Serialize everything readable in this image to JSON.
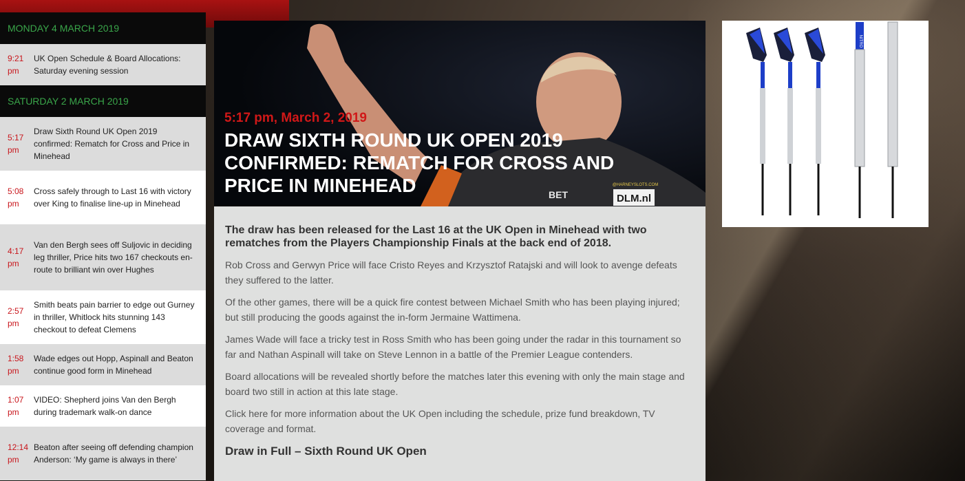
{
  "sidebar": {
    "days": [
      {
        "date": "MONDAY 4 MARCH 2019",
        "items": [
          {
            "time": "9:21 pm",
            "title": "UK Open Schedule & Board Allocations: Saturday evening session"
          }
        ]
      },
      {
        "date": "SATURDAY 2 MARCH 2019",
        "items": [
          {
            "time": "5:17 pm",
            "title": "Draw Sixth Round UK Open 2019 confirmed: Rematch for Cross and Price in Minehead"
          },
          {
            "time": "5:08 pm",
            "title": "Cross safely through to Last 16 with victory over King to finalise line-up in Minehead"
          },
          {
            "time": "4:17 pm",
            "title": "Van den Bergh sees off Suljovic in deciding leg thriller, Price hits two 167 checkouts en-route to brilliant win over Hughes"
          },
          {
            "time": "2:57 pm",
            "title": "Smith beats pain barrier to edge out Gurney in thriller, Whitlock hits stunning 143 checkout to defeat Clemens"
          },
          {
            "time": "1:58 pm",
            "title": "Wade edges out Hopp, Aspinall and Beaton continue good form in Minehead"
          },
          {
            "time": "1:07 pm",
            "title": "VIDEO: Shepherd joins Van den Bergh during trademark walk-on dance"
          },
          {
            "time": "12:14 pm",
            "title": "Beaton after seeing off defending champion Anderson: ‘My game is always in there’"
          }
        ]
      }
    ]
  },
  "article": {
    "date": "5:17 pm, March 2, 2019",
    "headline": "Draw Sixth Round UK Open 2019 confirmed: Rematch for Cross and Price in Minehead",
    "lead": "The draw has been released for the Last 16 at the UK Open in Minehead with two rematches from the Players Championship Finals at the back end of 2018.",
    "paragraphs": [
      "Rob Cross and Gerwyn Price will face Cristo Reyes and Krzysztof Ratajski and will look to avenge defeats they suffered to the latter.",
      "Of the other games, there will be a quick fire contest between Michael Smith who has been playing injured; but still producing the goods against the in-form Jermaine Wattimena.",
      "James Wade will face a tricky test in Ross Smith who has been going under the radar in this tournament so far and Nathan Aspinall will take on Steve Lennon in a battle of the Premier League contenders.",
      "Board allocations will be revealed shortly before the matches later this evening with only the main stage and board two still in action at this late stage.",
      "Click here for more information about the UK Open including the schedule, prize fund breakdown, TV coverage and format."
    ],
    "subheading": "Draw in Full – Sixth Round UK Open",
    "photo_sponsor_1": "DLM.nl",
    "photo_sponsor_2": "BET",
    "photo_sponsor_3": "@HARNEYSLOTS.COM"
  },
  "ad": {
    "brand_text": "NITRO",
    "icon": "darts-product-image"
  },
  "colors": {
    "accent_red": "#c8151b",
    "date_green": "#3aa64a",
    "sidebar_dark": "#0a0a0a",
    "article_bg": "#dfe0df"
  }
}
